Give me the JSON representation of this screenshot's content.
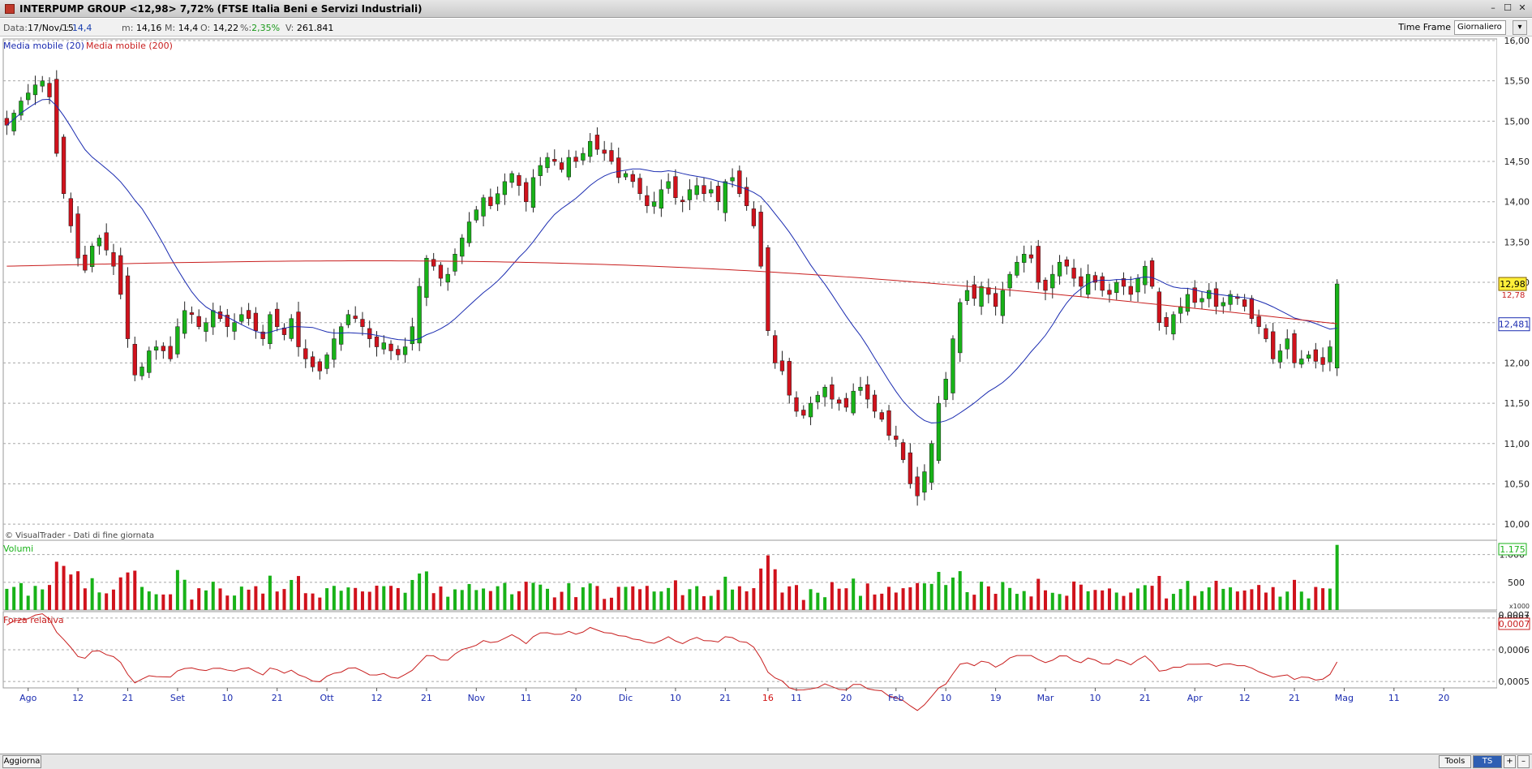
{
  "window": {
    "title": "INTERPUMP GROUP <12,98> 7,72% (FTSE Italia Beni e Servizi Industriali)",
    "buttons": [
      "–",
      "☐",
      "✕"
    ]
  },
  "infobar": {
    "date_label": "Data:",
    "date_value": "17/Nov/15",
    "close_label": "C:",
    "close_value": "14,4",
    "min_label": "m:",
    "min_value": "14,16",
    "max_label": "M:",
    "max_value": "14,4",
    "open_label": "O:",
    "open_value": "14,22",
    "pct_label": "%:",
    "pct_value": "2,35%",
    "vol_label": "V:",
    "vol_value": "261.841",
    "timeframe_label": "Time Frame",
    "timeframe_value": "Giornaliero"
  },
  "bottombar": {
    "update_label": "Aggiorna",
    "tools_label": "Tools",
    "ts_label": "TS OFF",
    "plus_label": "+",
    "minus_label": "–"
  },
  "colors": {
    "up": "#18b218",
    "down": "#d0121c",
    "ma20": "#1a2bb0",
    "ma200": "#c81e1e",
    "grid": "#a8a8a8"
  },
  "chart_data": {
    "type": "candlestick",
    "copyright": "© VisualTrader - Dati di fine giornata",
    "legend": [
      {
        "name": "Media mobile (20)",
        "color": "#1a2bb0"
      },
      {
        "name": "Media mobile (200)",
        "color": "#c81e1e"
      }
    ],
    "price_panel": {
      "ylim": [
        9.8,
        16.02
      ],
      "yticks": [
        10.0,
        10.5,
        11.0,
        11.5,
        12.0,
        12.5,
        13.0,
        13.5,
        14.0,
        14.5,
        15.0,
        15.5,
        16.0
      ],
      "ytick_labels": [
        "10,00",
        "10,50",
        "11,00",
        "11,50",
        "12,00",
        "12,50",
        "13,00",
        "13,50",
        "14,00",
        "14,50",
        "15,00",
        "15,50",
        "16,00"
      ],
      "last_price_label": "12,98",
      "last_price": 12.98,
      "ma200_label": "12,481",
      "ma200_last": 12.48,
      "ma20_label": "12,78"
    },
    "volume_panel": {
      "title": "Volumi",
      "unit_label": "x1000",
      "ylim": [
        0,
        1200
      ],
      "yticks": [
        500,
        1000
      ],
      "ytick_labels": [
        "500",
        "1.000"
      ],
      "last_label": "1.175"
    },
    "rs_panel": {
      "title": "Forza relativa",
      "ylim": [
        0.00048,
        0.00072
      ],
      "yticks": [
        0.0005,
        0.0006,
        0.0007
      ],
      "ytick_labels": [
        "0,0005",
        "0,0006",
        "0,0007"
      ],
      "top_label": "0,0007",
      "last_label": "0,0007"
    },
    "x_labels": [
      {
        "i": 3,
        "text": "Ago"
      },
      {
        "i": 10,
        "text": "12"
      },
      {
        "i": 17,
        "text": "21"
      },
      {
        "i": 24,
        "text": "Set"
      },
      {
        "i": 31,
        "text": "10"
      },
      {
        "i": 38,
        "text": "21"
      },
      {
        "i": 45,
        "text": "Ott"
      },
      {
        "i": 52,
        "text": "12"
      },
      {
        "i": 59,
        "text": "21"
      },
      {
        "i": 66,
        "text": "Nov"
      },
      {
        "i": 73,
        "text": "11"
      },
      {
        "i": 80,
        "text": "20"
      },
      {
        "i": 87,
        "text": "Dic"
      },
      {
        "i": 94,
        "text": "10"
      },
      {
        "i": 101,
        "text": "21"
      },
      {
        "i": 107,
        "text": "16",
        "red": true
      },
      {
        "i": 111,
        "text": "11"
      },
      {
        "i": 118,
        "text": "20"
      },
      {
        "i": 125,
        "text": "Feb"
      },
      {
        "i": 132,
        "text": "10"
      },
      {
        "i": 139,
        "text": "19"
      },
      {
        "i": 146,
        "text": "Mar"
      },
      {
        "i": 153,
        "text": "10"
      },
      {
        "i": 160,
        "text": "21"
      },
      {
        "i": 167,
        "text": "Apr"
      },
      {
        "i": 174,
        "text": "12"
      },
      {
        "i": 181,
        "text": "21"
      },
      {
        "i": 188,
        "text": "Mag"
      },
      {
        "i": 195,
        "text": "11"
      },
      {
        "i": 202,
        "text": "20"
      }
    ],
    "close": [
      14.95,
      15.1,
      15.25,
      15.35,
      15.45,
      15.5,
      15.3,
      14.6,
      14.1,
      13.7,
      13.3,
      13.15,
      13.45,
      13.55,
      13.4,
      13.2,
      12.85,
      12.3,
      11.85,
      11.95,
      12.15,
      12.2,
      12.15,
      12.05,
      12.45,
      12.65,
      12.6,
      12.45,
      12.5,
      12.65,
      12.55,
      12.45,
      12.5,
      12.6,
      12.55,
      12.4,
      12.3,
      12.6,
      12.45,
      12.35,
      12.55,
      12.2,
      12.05,
      11.95,
      11.9,
      12.1,
      12.3,
      12.45,
      12.6,
      12.55,
      12.45,
      12.3,
      12.2,
      12.25,
      12.15,
      12.1,
      12.2,
      12.45,
      12.95,
      13.3,
      13.2,
      13.05,
      13.1,
      13.35,
      13.55,
      13.75,
      13.9,
      14.05,
      13.95,
      14.1,
      14.25,
      14.35,
      14.2,
      14.0,
      14.3,
      14.45,
      14.55,
      14.5,
      14.4,
      14.55,
      14.5,
      14.6,
      14.75,
      14.65,
      14.6,
      14.5,
      14.3,
      14.35,
      14.25,
      14.1,
      13.95,
      14.0,
      14.15,
      14.25,
      14.05,
      14.0,
      14.15,
      14.2,
      14.1,
      14.15,
      14.0,
      14.25,
      14.3,
      14.1,
      13.95,
      13.7,
      13.2,
      12.4,
      12.0,
      11.9,
      11.6,
      11.4,
      11.35,
      11.5,
      11.6,
      11.7,
      11.55,
      11.5,
      11.45,
      11.65,
      11.7,
      11.55,
      11.4,
      11.3,
      11.1,
      11.05,
      10.8,
      10.5,
      10.35,
      10.65,
      11.0,
      11.5,
      11.8,
      12.3,
      12.75,
      12.9,
      12.8,
      12.95,
      12.85,
      12.7,
      12.9,
      13.1,
      13.25,
      13.35,
      13.3,
      13.0,
      12.9,
      13.1,
      13.25,
      13.2,
      13.05,
      12.95,
      13.1,
      13.0,
      12.9,
      12.85,
      13.0,
      12.95,
      12.85,
      13.05,
      13.2,
      12.95,
      12.5,
      12.45,
      12.6,
      12.7,
      12.85,
      12.75,
      12.8,
      12.9,
      12.7,
      12.75,
      12.85,
      12.8,
      12.7,
      12.55,
      12.45,
      12.3,
      12.05,
      12.15,
      12.3,
      12.0,
      12.05,
      12.1,
      12.02,
      11.98,
      12.2,
      12.98
    ]
  }
}
